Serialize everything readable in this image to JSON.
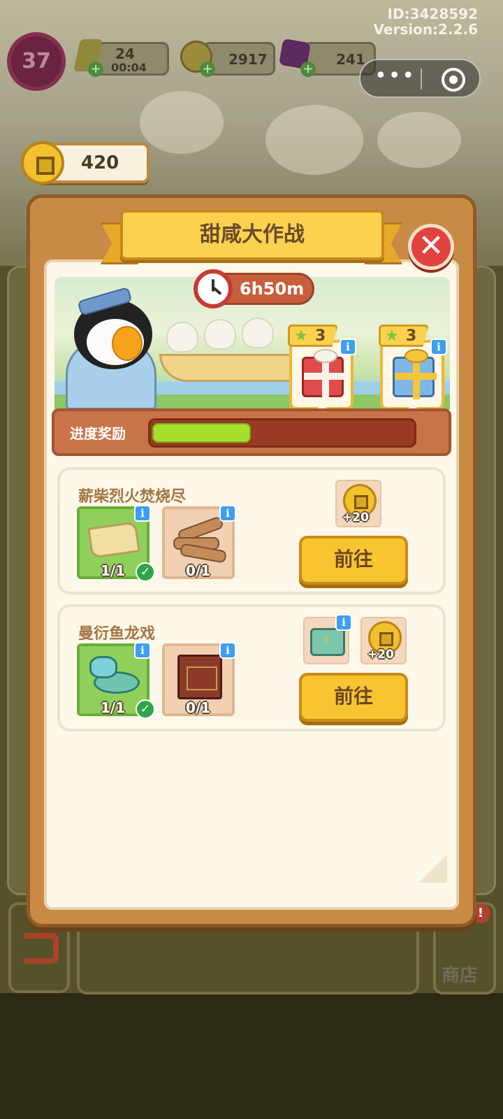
{
  "hud": {
    "id_text": "ID:3428592",
    "version_text": "Version:2.2.6",
    "level": "37",
    "energy": "24",
    "energy_timer": "00:04",
    "gold": "2917",
    "gems": "241",
    "event_coins": "420"
  },
  "dialog": {
    "title": "甜咸大作战",
    "close_symbol": "✕",
    "timer": "6h50m",
    "progress_label": "进度奖励",
    "progress_fraction": 0.38,
    "milestones": [
      {
        "points": "3",
        "gift_color": "#e04b4b",
        "ribbon_color": "#f7f2e8"
      },
      {
        "points": "3",
        "gift_color": "#7fb6e6",
        "ribbon_color": "#f6c53a"
      }
    ],
    "tasks": [
      {
        "title": "薪柴烈火焚烧尽",
        "requirements": [
          {
            "item": "paper-icon",
            "count": "1/1",
            "done": true
          },
          {
            "item": "firewood-icon",
            "count": "0/1",
            "done": false
          }
        ],
        "rewards": [
          {
            "item": "event-coin-icon",
            "amount": "+20"
          }
        ],
        "button": "前往"
      },
      {
        "title": "曼衍鱼龙戏",
        "requirements": [
          {
            "item": "dragon-toy-icon",
            "count": "1/1",
            "done": true
          },
          {
            "item": "cabinet-icon",
            "count": "0/1",
            "done": false
          }
        ],
        "rewards": [
          {
            "item": "energy-chest-icon",
            "amount": ""
          },
          {
            "item": "event-coin-icon",
            "amount": "+20"
          }
        ],
        "button": "前往"
      }
    ]
  },
  "background": {
    "shop_label": "商店",
    "shop_badge": "!"
  },
  "colors": {
    "panel": "#c88a45",
    "banner": "#fbd150",
    "progress_fill": "#a6e02d",
    "close": "#e2433e"
  },
  "icons": {
    "info_glyph": "i",
    "check_glyph": "✓",
    "star_glyph": "★"
  }
}
